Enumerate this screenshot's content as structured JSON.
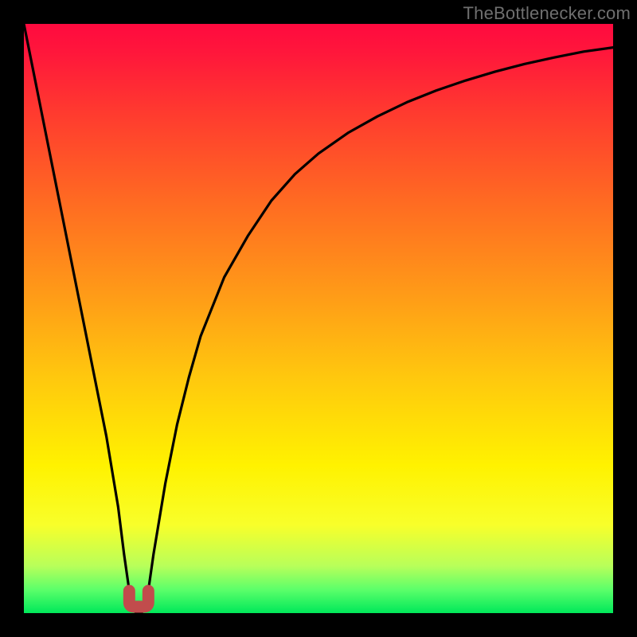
{
  "watermark": {
    "text": "TheBottlenecker.com"
  },
  "colors": {
    "frame": "#000000",
    "watermark_text": "#6f6f6f",
    "curve_stroke": "#000000",
    "marker_fill": "#c14c4c",
    "gradient_stops": [
      "#ff0a3f",
      "#ff173b",
      "#ff3a2f",
      "#ff6a22",
      "#ff9818",
      "#ffc80e",
      "#fff200",
      "#f8ff2a",
      "#b8ff5a",
      "#5cff6a",
      "#00e85a"
    ]
  },
  "chart_data": {
    "type": "line",
    "title": "",
    "xlabel": "",
    "ylabel": "",
    "xlim": [
      0,
      100
    ],
    "ylim": [
      0,
      100
    ],
    "x": [
      0,
      2,
      4,
      6,
      8,
      10,
      12,
      14,
      16,
      17,
      18,
      19,
      20,
      21,
      22,
      24,
      26,
      28,
      30,
      32,
      34,
      38,
      42,
      46,
      50,
      55,
      60,
      65,
      70,
      75,
      80,
      85,
      90,
      95,
      100
    ],
    "series": [
      {
        "name": "bottleneck-curve",
        "values": [
          100,
          90,
          80,
          70,
          60,
          50,
          40,
          30,
          18,
          10,
          3,
          0,
          0,
          3,
          10,
          22,
          32,
          40,
          47,
          52,
          57,
          64,
          70,
          74.5,
          78,
          81.5,
          84.3,
          86.7,
          88.7,
          90.4,
          91.9,
          93.2,
          94.3,
          95.3,
          96
        ]
      }
    ],
    "annotations": [
      {
        "name": "optimum-marker",
        "shape": "u",
        "x": 19.5,
        "y": 0
      }
    ]
  }
}
